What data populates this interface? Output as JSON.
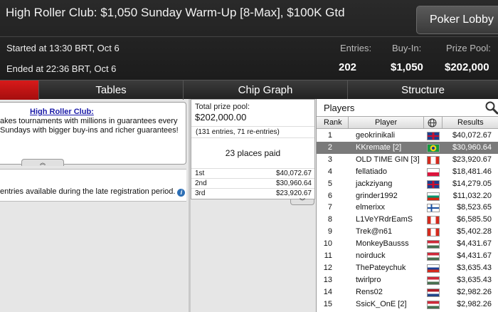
{
  "header": {
    "title": "High Roller Club: $1,050 Sunday Warm-Up [8-Max], $100K Gtd",
    "lobby_button": "Poker Lobby",
    "started": "Started at 13:30 BRT, Oct 6",
    "ended": "Ended at 22:36 BRT, Oct 6",
    "stats": {
      "entries_label": "Entries:",
      "entries_value": "202",
      "buyin_label": "Buy-In:",
      "buyin_value": "$1,050",
      "prizepool_label": "Prize Pool:",
      "prizepool_value": "$202,000"
    }
  },
  "tabs": [
    "",
    "Tables",
    "Chip Graph",
    "Structure"
  ],
  "description": {
    "title": "High Roller Club:",
    "text": "akes tournaments with millions in guarantees every\nSundays with bigger buy-ins and richer guarantees!"
  },
  "late_reg_text": "entries available during the late registration period.",
  "info_icon_glyph": "i",
  "prize": {
    "label": "Total prize pool:",
    "value": "$202,000.00",
    "entries_note": "(131 entries, 71 re-entries)",
    "places_paid": "23 places paid",
    "payouts": [
      {
        "place": "1st",
        "amount": "$40,072.67"
      },
      {
        "place": "2nd",
        "amount": "$30,960.64"
      },
      {
        "place": "3rd",
        "amount": "$23,920.67"
      }
    ]
  },
  "players": {
    "title": "Players",
    "columns": {
      "rank": "Rank",
      "player": "Player",
      "results": "Results"
    },
    "rows": [
      {
        "rank": "1",
        "name": "geokrinikali",
        "flag": "gb",
        "result": "$40,072.67"
      },
      {
        "rank": "2",
        "name": "KKremate [2]",
        "flag": "br",
        "result": "$30,960.64",
        "selected": true
      },
      {
        "rank": "3",
        "name": "OLD TIME GIN [3]",
        "flag": "ca",
        "result": "$23,920.67"
      },
      {
        "rank": "4",
        "name": "fellatiado",
        "flag": "pl",
        "result": "$18,481.46"
      },
      {
        "rank": "5",
        "name": "jackziyang",
        "flag": "gb",
        "result": "$14,279.05"
      },
      {
        "rank": "6",
        "name": "grinder1992",
        "flag": "bg",
        "result": "$11,032.20"
      },
      {
        "rank": "7",
        "name": "elmerixx",
        "flag": "fi",
        "result": "$8,523.65"
      },
      {
        "rank": "8",
        "name": "L1VeYRdrEamS",
        "flag": "ca",
        "result": "$6,585.50"
      },
      {
        "rank": "9",
        "name": "Trek@n61",
        "flag": "ca",
        "result": "$5,402.28"
      },
      {
        "rank": "10",
        "name": "MonkeyBausss",
        "flag": "hu",
        "result": "$4,431.67"
      },
      {
        "rank": "11",
        "name": "noirduck",
        "flag": "hu",
        "result": "$4,431.67"
      },
      {
        "rank": "12",
        "name": "ThePateychuk",
        "flag": "ru",
        "result": "$3,635.43"
      },
      {
        "rank": "13",
        "name": "twirlpro",
        "flag": "hu",
        "result": "$3,635.43"
      },
      {
        "rank": "14",
        "name": "Rens02",
        "flag": "nl",
        "result": "$2,982.26"
      },
      {
        "rank": "15",
        "name": "SsicK_OnE [2]",
        "flag": "hu",
        "result": "$2,982.26"
      }
    ]
  },
  "colors": {
    "accent_red": "#c41212",
    "selected_row": "#7a7a7a"
  }
}
